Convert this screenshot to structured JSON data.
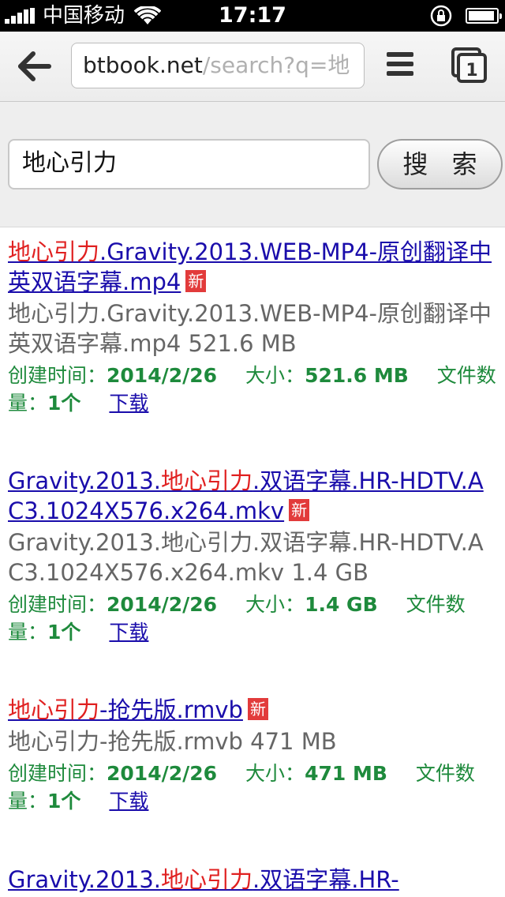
{
  "status_bar": {
    "carrier": "中国移动",
    "time": "17:17"
  },
  "browser": {
    "url_host": "btbook.net",
    "url_path": "/search?q=地",
    "tab_count": "1"
  },
  "search": {
    "query": "地心引力",
    "button_label": "搜 索"
  },
  "labels": {
    "created": "创建时间：",
    "size": "大小：",
    "file_count": "文件数量：",
    "download": "下载",
    "new": "新"
  },
  "results": [
    {
      "title_pre": "",
      "title_hl": "地心引力",
      "title_post": ".Gravity.2013.WEB-MP4-原创翻译中英双语字幕.mp4",
      "desc": "地心引力.Gravity.2013.WEB-MP4-原创翻译中英双语字幕.mp4  521.6 MB",
      "date": "2014/2/26",
      "size": "521.6 MB",
      "count": "1个"
    },
    {
      "title_pre": "Gravity.2013.",
      "title_hl": "地心引力",
      "title_post": ".双语字幕.HR-HDTV.AC3.1024X576.x264.mkv",
      "desc": "Gravity.2013.地心引力.双语字幕.HR-HDTV.AC3.1024X576.x264.mkv  1.4 GB",
      "date": "2014/2/26",
      "size": "1.4 GB",
      "count": "1个"
    },
    {
      "title_pre": "",
      "title_hl": "地心引力",
      "title_post": "-抢先版.rmvb",
      "desc": "地心引力-抢先版.rmvb  471 MB",
      "date": "2014/2/26",
      "size": "471 MB",
      "count": "1个"
    },
    {
      "title_pre": "Gravity.2013.",
      "title_hl": "地心引力",
      "title_post": ".双语字幕.HR-",
      "desc": "",
      "date": "",
      "size": "",
      "count": ""
    }
  ]
}
